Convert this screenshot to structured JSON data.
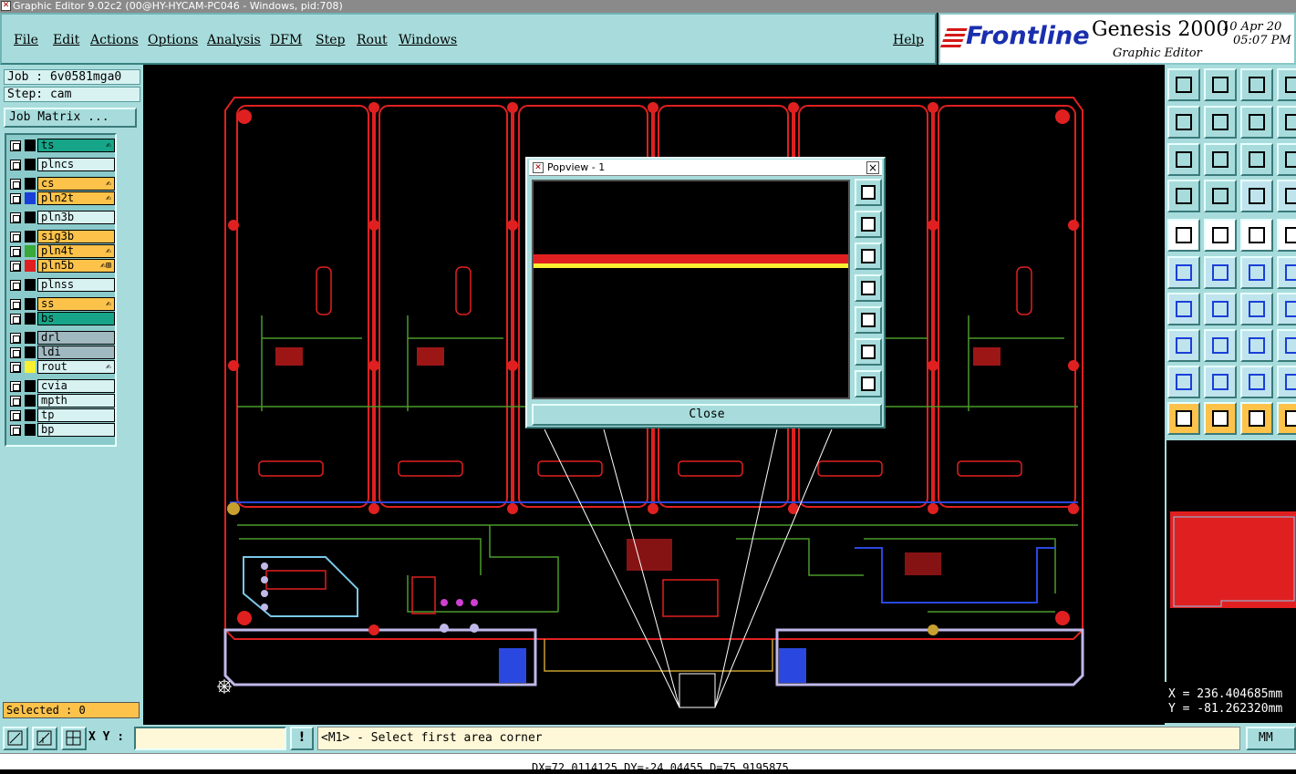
{
  "window": {
    "title": "Graphic Editor 9.02c2 (00@HY-HYCAM-PC046 - Windows, pid:708)"
  },
  "menu": [
    {
      "label": "File",
      "name": "menu-file"
    },
    {
      "label": "Edit",
      "name": "menu-edit"
    },
    {
      "label": "Actions",
      "name": "menu-actions"
    },
    {
      "label": "Options",
      "name": "menu-options"
    },
    {
      "label": "Analysis",
      "name": "menu-analysis"
    },
    {
      "label": "DFM",
      "name": "menu-dfm"
    },
    {
      "label": "Step",
      "name": "menu-step"
    },
    {
      "label": "Rout",
      "name": "menu-rout"
    },
    {
      "label": "Windows",
      "name": "menu-windows"
    }
  ],
  "help_label": "Help",
  "branding": {
    "company": "Frontline",
    "product": "Genesis 2000",
    "subtitle": "Graphic Editor",
    "date": "10 Apr 20",
    "time": "05:07 PM"
  },
  "job": {
    "job_label": "Job : 6v0581mga0",
    "step_label": "Step: cam",
    "matrix_button": "Job Matrix ..."
  },
  "layers": [
    {
      "name": "ts",
      "color": "#17a589",
      "swatch": "#000000",
      "mark": "✍"
    },
    {
      "name": "plncs",
      "color": "#d8f2f2",
      "swatch": "#000000",
      "mark": ""
    },
    {
      "name": "cs",
      "color": "#fcc24a",
      "swatch": "#000000",
      "mark": "✍"
    },
    {
      "name": "pln2t",
      "color": "#fcc24a",
      "swatch": "#1a3fd8",
      "mark": "✍"
    },
    {
      "name": "pln3b",
      "color": "#d8f2f2",
      "swatch": "#000000",
      "mark": ""
    },
    {
      "name": "sig3b",
      "color": "#fcc24a",
      "swatch": "#000000",
      "mark": ""
    },
    {
      "name": "pln4t",
      "color": "#fcc24a",
      "swatch": "#3aa83a",
      "mark": "✍"
    },
    {
      "name": "pln5b",
      "color": "#fcc24a",
      "swatch": "#e02020",
      "mark": "✍⊞"
    },
    {
      "name": "plnss",
      "color": "#d8f2f2",
      "swatch": "#000000",
      "mark": ""
    },
    {
      "name": "ss",
      "color": "#fcc24a",
      "swatch": "#000000",
      "mark": "✍"
    },
    {
      "name": "bs",
      "color": "#17a589",
      "swatch": "#000000",
      "mark": ""
    },
    {
      "name": "drl",
      "color": "#a0b8c0",
      "swatch": "#000000",
      "mark": ""
    },
    {
      "name": "ldi",
      "color": "#a0b8c0",
      "swatch": "#000000",
      "mark": ""
    },
    {
      "name": "rout",
      "color": "#d8f2f2",
      "swatch": "#f8f030",
      "mark": "✍"
    },
    {
      "name": "cvia",
      "color": "#d8f2f2",
      "swatch": "#000000",
      "mark": ""
    },
    {
      "name": "mpth",
      "color": "#d8f2f2",
      "swatch": "#000000",
      "mark": ""
    },
    {
      "name": "tp",
      "color": "#d8f2f2",
      "swatch": "#000000",
      "mark": ""
    },
    {
      "name": "bp",
      "color": "#d8f2f2",
      "swatch": "#000000",
      "mark": ""
    }
  ],
  "selected_label": "Selected : 0",
  "popup": {
    "title": "Popview - 1",
    "close_label": "Close"
  },
  "coords": {
    "x": "X = 236.404685mm",
    "y": "Y = -81.262320mm"
  },
  "bottom": {
    "xy_label": "X Y :",
    "xy_value": "",
    "message": "<M1> - Select first area corner",
    "units": "MM"
  },
  "status": {
    "text": "DX=72.0114125 DY=-24.04455 D=75.9195875"
  },
  "toolbar_icons": [
    "snap-icon",
    "zoom-home-icon",
    "home-icon",
    "zoom-in-icon",
    "zoom-out-icon",
    "pan-icon",
    "one-to-one-icon",
    "help-icon",
    "measure-icon",
    "route-icon",
    "layers-icon",
    "pointer-icon"
  ]
}
